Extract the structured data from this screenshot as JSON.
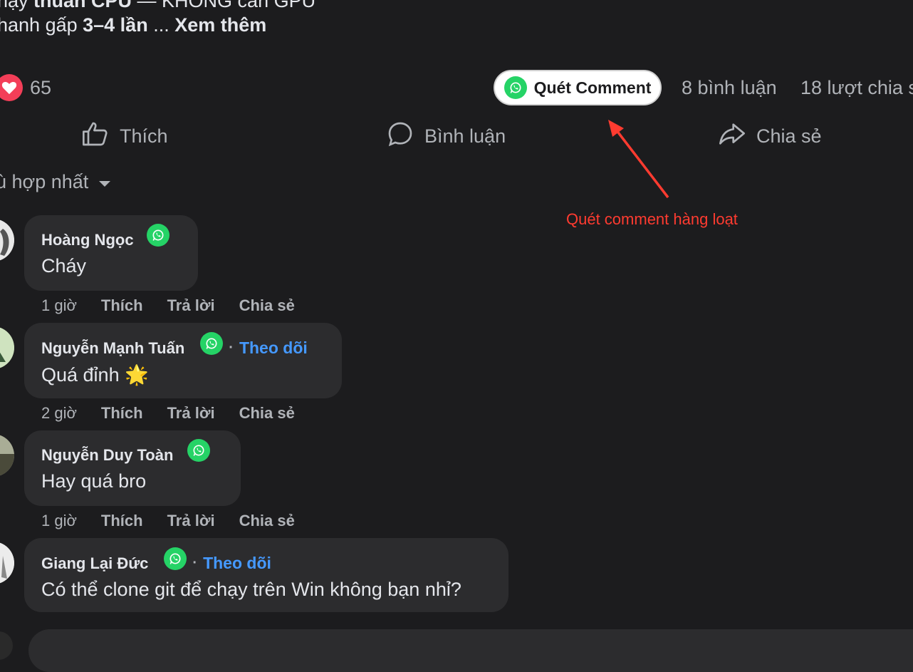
{
  "post": {
    "line1_prefix": "hạy ",
    "line1_bold": "thuần CPU",
    "line1_rest": " — KHÔNG cần GPU",
    "line2_prefix": "hanh gấp ",
    "line2_bold": "3–4 lần",
    "line2_ellipsis": " ... ",
    "see_more": "Xem thêm"
  },
  "stats": {
    "reaction_count": "65",
    "comments": "8 bình luận",
    "shares": "18 lượt chia s"
  },
  "scan_button": {
    "label": "Quét Comment"
  },
  "actions": {
    "like": "Thích",
    "comment": "Bình luận",
    "share": "Chia sẻ"
  },
  "annotation": {
    "text": "Quét comment hàng loạt",
    "color": "#ff3b30"
  },
  "sort": {
    "label": "ù hợp nhất"
  },
  "comments": [
    {
      "name": "Hoàng Ngọc",
      "text": "Cháy",
      "follow": "",
      "time": "1 giờ",
      "like": "Thích",
      "reply": "Trả lời",
      "share": "Chia sẻ"
    },
    {
      "name": "Nguyễn Mạnh Tuấn",
      "text": "Quá đỉnh 🌟",
      "follow": "Theo dõi",
      "time": "2 giờ",
      "like": "Thích",
      "reply": "Trả lời",
      "share": "Chia sẻ"
    },
    {
      "name": "Nguyễn Duy Toàn",
      "text": "Hay quá bro",
      "follow": "",
      "time": "1 giờ",
      "like": "Thích",
      "reply": "Trả lời",
      "share": "Chia sẻ"
    },
    {
      "name": "Giang Lại Đức",
      "text": "Có thể clone git để chạy trên Win không bạn nhỉ?",
      "follow": "Theo dõi"
    }
  ],
  "colors": {
    "background": "#1c1c1e",
    "bubble": "#2c2c2e",
    "link_blue": "#4599ff",
    "heart": "#f33e58",
    "whatsapp_green": "#25d366"
  },
  "icons": [
    "heart-icon",
    "whatsapp-icon",
    "like-icon",
    "comment-icon",
    "share-icon",
    "caret-down-icon",
    "avatar"
  ]
}
